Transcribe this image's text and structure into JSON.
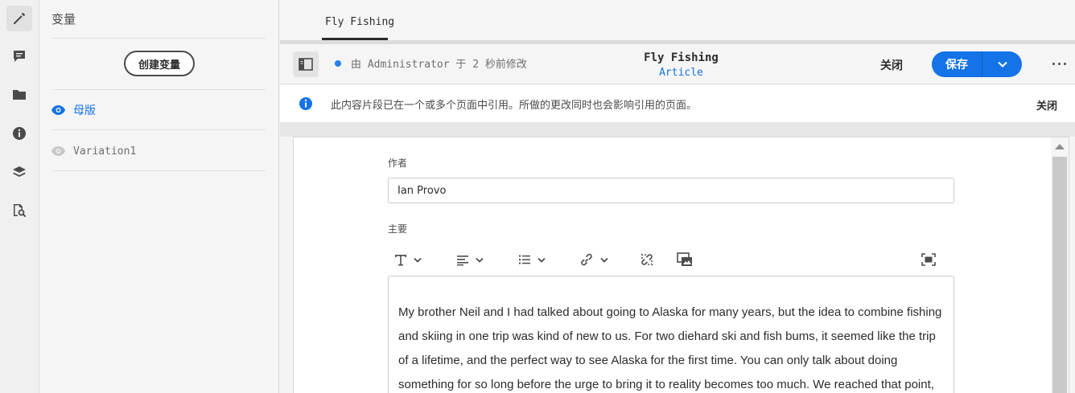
{
  "rail": {
    "items": [
      {
        "icon": "pencil-icon",
        "active": true
      },
      {
        "icon": "comment-icon",
        "active": false
      },
      {
        "icon": "folder-icon",
        "active": false
      },
      {
        "icon": "info-icon",
        "active": false
      },
      {
        "icon": "layers-icon",
        "active": false
      },
      {
        "icon": "find-references-icon",
        "active": false
      }
    ]
  },
  "panel": {
    "title": "变量",
    "create_label": "创建变量",
    "variations": [
      {
        "label": "母版",
        "selected": true
      },
      {
        "label": "Variation1",
        "selected": false
      }
    ]
  },
  "tabs": [
    {
      "label": "Fly Fishing",
      "active": true
    }
  ],
  "header": {
    "status": "由 Administrator 于 2 秒前修改",
    "title": "Fly Fishing",
    "model": "Article",
    "close_label": "关闭",
    "save_label": "保存"
  },
  "infobar": {
    "message": "此内容片段已在一个或多个页面中引用。所做的更改同时也会影响引用的页面。",
    "close_label": "关闭"
  },
  "editor": {
    "author_label": "作者",
    "author_value": "Ian Provo",
    "main_label": "主要",
    "toolbar": [
      "text-format-icon",
      "align-icon",
      "list-icon",
      "link-icon",
      "unlink-icon",
      "insert-asset-icon",
      "fullscreen-icon"
    ],
    "body": "My brother Neil and I had talked about going to Alaska for many years, but the idea to combine fishing and skiing in one trip was kind of new to us. For two diehard ski and fish bums, it seemed like the trip of a lifetime, and the perfect way to see Alaska for the first time. You can only talk about doing something for so long before the urge to bring it to reality becomes too much. We reached that point, and for the first time in our"
  },
  "colors": {
    "accent": "#1473e6",
    "status_dot": "#2680eb"
  }
}
